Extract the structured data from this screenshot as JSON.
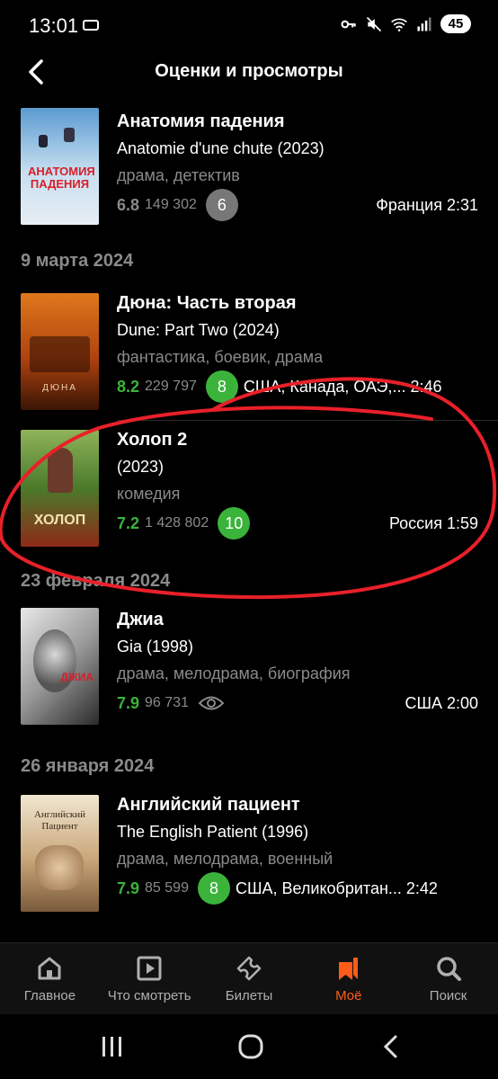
{
  "status_bar": {
    "time": "13:01",
    "battery": "45",
    "icons": [
      "key-icon",
      "mute-icon",
      "wifi-icon",
      "signal-icon"
    ]
  },
  "header": {
    "title": "Оценки и просмотры",
    "back_icon": "back-arrow-icon"
  },
  "films": [
    {
      "title": "Анатомия падения",
      "original": "Anatomie d'une chute (2023)",
      "genres": "драма, детектив",
      "rating": "6.8",
      "votes": "149 302",
      "user_score": "6",
      "meta": "Франция 2:31",
      "poster_text": "АНАТОМИЯ ПАДЕНИЯ"
    },
    {
      "title": "Дюна: Часть вторая",
      "original": "Dune: Part Two (2024)",
      "genres": "фантастика, боевик, драма",
      "rating": "8.2",
      "votes": "229 797",
      "user_score": "8",
      "meta": "США, Канада, ОАЭ,... 2:46",
      "poster_text": "ДЮНА"
    },
    {
      "title": "Холоп 2",
      "original": "(2023)",
      "genres": "комедия",
      "rating": "7.2",
      "votes": "1 428 802",
      "user_score": "10",
      "meta": "Россия 1:59",
      "poster_text": "ХОЛОП"
    },
    {
      "title": "Джиа",
      "original": "Gia (1998)",
      "genres": "драма, мелодрама, биография",
      "rating": "7.9",
      "votes": "96 731",
      "user_score": "",
      "meta": "США 2:00",
      "poster_text": "ДЖИА"
    },
    {
      "title": "Английский пациент",
      "original": "The English Patient (1996)",
      "genres": "драма, мелодрама, военный",
      "rating": "7.9",
      "votes": "85 599",
      "user_score": "8",
      "meta": "США, Великобритан... 2:42",
      "poster_text": "Английский Пациент"
    }
  ],
  "dates": [
    "9 марта 2024",
    "23 февраля 2024",
    "26 января 2024"
  ],
  "tabs": [
    {
      "label": "Главное",
      "icon": "home-icon"
    },
    {
      "label": "Что смотреть",
      "icon": "play-icon"
    },
    {
      "label": "Билеты",
      "icon": "ticket-icon"
    },
    {
      "label": "Моё",
      "icon": "bookmarks-icon",
      "active": true
    },
    {
      "label": "Поиск",
      "icon": "search-icon"
    }
  ],
  "colors": {
    "accent": "#ff5c1a",
    "rating_green": "#3bb33b",
    "muted": "#8a8a8a",
    "annotation": "#e8202a"
  }
}
